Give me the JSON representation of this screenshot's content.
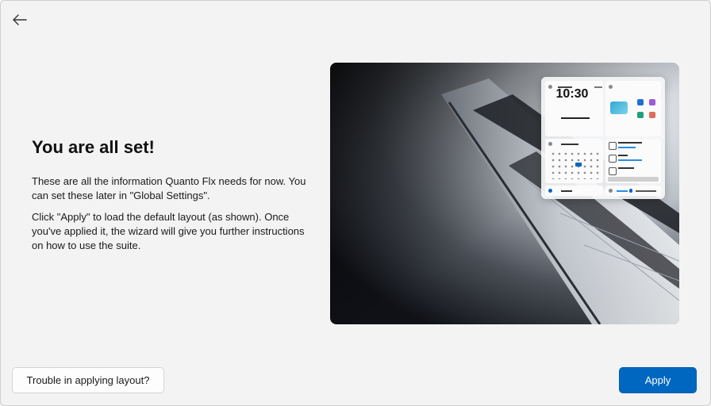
{
  "header": {
    "back_icon": "arrow-left-icon"
  },
  "content": {
    "title": "You are all set!",
    "paragraph_1": "These are all the information Quanto Flx needs for now. You can set these later in \"Global Settings\".",
    "paragraph_2": "Click \"Apply\" to load the default layout (as shown). Once you've applied it, the wizard will give you further instructions on how to use the suite."
  },
  "preview": {
    "clock_text": "10:30"
  },
  "footer": {
    "trouble_label": "Trouble in applying layout?",
    "apply_label": "Apply"
  },
  "colors": {
    "accent": "#0067c0",
    "background": "#f3f3f3"
  }
}
